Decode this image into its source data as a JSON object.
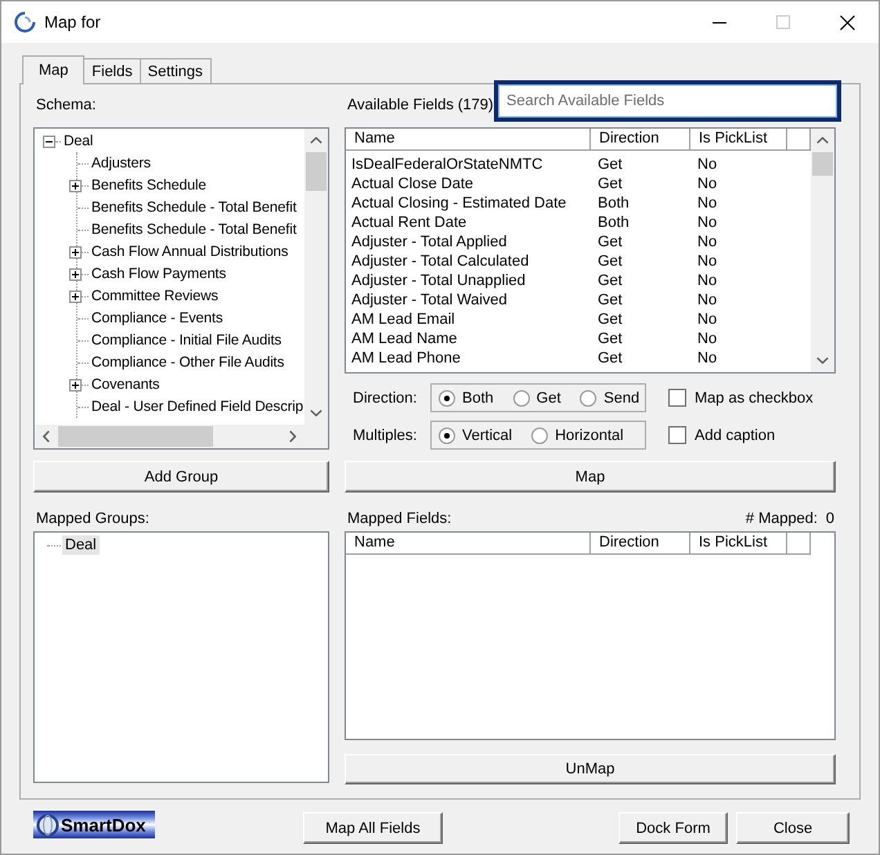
{
  "window": {
    "title": "Map for",
    "maximize_disabled": true
  },
  "tabs": [
    {
      "label": "Map",
      "selected": true
    },
    {
      "label": "Fields",
      "selected": false
    },
    {
      "label": "Settings",
      "selected": false
    }
  ],
  "schema": {
    "label": "Schema:",
    "tree": [
      {
        "label": "Deal",
        "expanded": true,
        "children": [
          {
            "label": "Adjusters",
            "kind": "leaf"
          },
          {
            "label": "Benefits Schedule",
            "kind": "branch"
          },
          {
            "label": "Benefits Schedule - Total Benefit",
            "kind": "leaf"
          },
          {
            "label": "Benefits Schedule - Total Benefit",
            "kind": "leaf"
          },
          {
            "label": "Cash Flow Annual Distributions",
            "kind": "branch"
          },
          {
            "label": "Cash Flow Payments",
            "kind": "branch"
          },
          {
            "label": "Committee Reviews",
            "kind": "branch"
          },
          {
            "label": "Compliance - Events",
            "kind": "leaf"
          },
          {
            "label": "Compliance - Initial File Audits",
            "kind": "leaf"
          },
          {
            "label": "Compliance - Other File Audits",
            "kind": "leaf"
          },
          {
            "label": "Covenants",
            "kind": "branch"
          },
          {
            "label": "Deal - User Defined Field Descrip",
            "kind": "leaf"
          }
        ]
      }
    ]
  },
  "add_group_button": "Add Group",
  "available_fields": {
    "label": "Available Fields (179)",
    "search": {
      "placeholder": "Search Available Fields",
      "focused": true
    },
    "columns": [
      "Name",
      "Direction",
      "Is PickList"
    ],
    "rows": [
      {
        "name": "IsDealFederalOrStateNMTC",
        "direction": "Get",
        "is_picklist": "No"
      },
      {
        "name": "Actual Close Date",
        "direction": "Get",
        "is_picklist": "No"
      },
      {
        "name": "Actual Closing - Estimated Date",
        "direction": "Both",
        "is_picklist": "No"
      },
      {
        "name": "Actual Rent Date",
        "direction": "Both",
        "is_picklist": "No"
      },
      {
        "name": "Adjuster - Total Applied",
        "direction": "Get",
        "is_picklist": "No"
      },
      {
        "name": "Adjuster - Total Calculated",
        "direction": "Get",
        "is_picklist": "No"
      },
      {
        "name": "Adjuster - Total Unapplied",
        "direction": "Get",
        "is_picklist": "No"
      },
      {
        "name": "Adjuster - Total Waived",
        "direction": "Get",
        "is_picklist": "No"
      },
      {
        "name": "AM Lead Email",
        "direction": "Get",
        "is_picklist": "No"
      },
      {
        "name": "AM Lead Name",
        "direction": "Get",
        "is_picklist": "No"
      },
      {
        "name": "AM Lead Phone",
        "direction": "Get",
        "is_picklist": "No"
      }
    ]
  },
  "direction": {
    "label": "Direction:",
    "options": [
      {
        "label": "Both",
        "selected": true
      },
      {
        "label": "Get",
        "selected": false
      },
      {
        "label": "Send",
        "selected": false
      }
    ]
  },
  "multiples": {
    "label": "Multiples:",
    "options": [
      {
        "label": "Vertical",
        "selected": true
      },
      {
        "label": "Horizontal",
        "selected": false
      }
    ]
  },
  "checkboxes": [
    {
      "label": "Map as checkbox",
      "checked": false
    },
    {
      "label": "Add caption",
      "checked": false
    }
  ],
  "map_button": "Map",
  "mapped_groups": {
    "label": "Mapped Groups:",
    "items": [
      {
        "label": "Deal",
        "selected": true
      }
    ]
  },
  "mapped_fields": {
    "label": "Mapped Fields:",
    "count_label": "# Mapped:",
    "count": "0",
    "columns": [
      "Name",
      "Direction",
      "Is PickList"
    ]
  },
  "unmap_button": "UnMap",
  "footer": {
    "logo": "SmartDox",
    "buttons": [
      "Map All Fields",
      "Dock Form",
      "Close"
    ]
  }
}
